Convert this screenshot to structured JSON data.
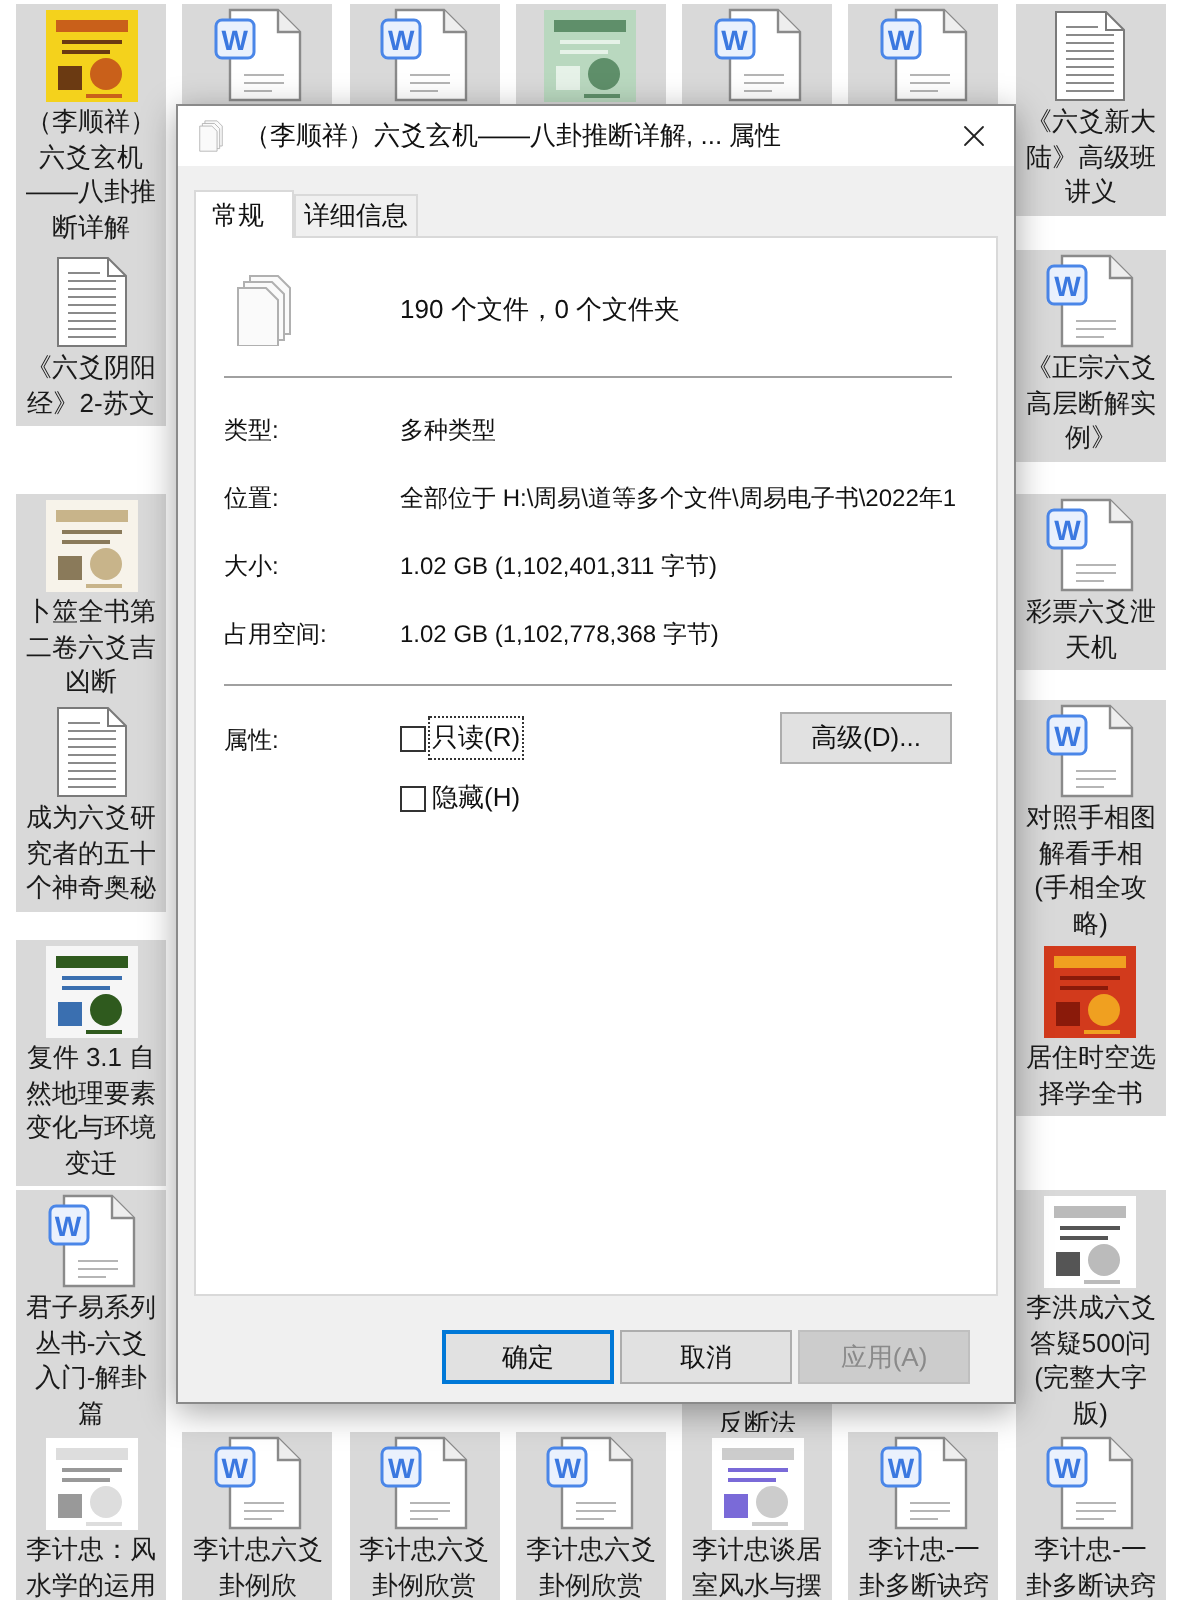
{
  "left_column": [
    {
      "kind": "picture",
      "name": "（李顺祥）六爻玄机——八卦推断详解"
    },
    {
      "kind": "document",
      "name": "《六爻阴阳经》2-苏文"
    },
    {
      "kind": "picture",
      "name": "卜筮全书第二卷六爻吉凶断"
    },
    {
      "kind": "document",
      "name": "成为六爻研究者的五十个神奇奥秘"
    },
    {
      "kind": "picture",
      "name": "复件 3.1 自然地理要素变化与环境变迁"
    },
    {
      "kind": "word",
      "icon_letter": "W",
      "name": "君子易系列丛书-六爻入门-解卦篇"
    },
    {
      "kind": "picture",
      "name": "李计忠：风水学的运用"
    }
  ],
  "right_column": [
    {
      "kind": "document",
      "name": "《六爻新大陆》高级班讲义"
    },
    {
      "kind": "word",
      "icon_letter": "W",
      "name": "《正宗六爻高层断解实例》"
    },
    {
      "kind": "word",
      "icon_letter": "W",
      "name": "彩票六爻泄天机"
    },
    {
      "kind": "word",
      "icon_letter": "W",
      "name": "对照手相图解看手相(手相全攻略)"
    },
    {
      "kind": "picture",
      "name": "居住时空选择学全书"
    },
    {
      "kind": "picture",
      "name": "李洪成六爻答疑500问(完整大字版)"
    },
    {
      "kind": "word",
      "icon_letter": "W",
      "name": "李计忠-一卦多断诀窍"
    }
  ],
  "top_middle": [
    {
      "kind": "word",
      "icon_letter": "W"
    },
    {
      "kind": "word",
      "icon_letter": "W"
    },
    {
      "kind": "picture"
    },
    {
      "kind": "word",
      "icon_letter": "W"
    },
    {
      "kind": "word",
      "icon_letter": "W"
    }
  ],
  "bottom_middle": [
    {
      "kind": "word",
      "icon_letter": "W",
      "name": "李计忠六爻卦例欣"
    },
    {
      "kind": "word",
      "icon_letter": "W",
      "name": "李计忠六爻卦例欣赏"
    },
    {
      "kind": "word",
      "icon_letter": "W",
      "name": "李计忠六爻卦例欣赏"
    },
    {
      "kind": "picture",
      "name": "李计忠谈居室风水与摆"
    },
    {
      "kind": "word",
      "icon_letter": "W",
      "name": "李计忠-一卦多断诀窍"
    }
  ],
  "covered_tile_label": "反断法",
  "dialog": {
    "title": "（李顺祥）六爻玄机——八卦推断详解, ... 属性",
    "tabs": [
      {
        "label": "常规",
        "selected": true
      },
      {
        "label": "详细信息",
        "selected": false
      }
    ],
    "summary": "190 个文件，0 个文件夹",
    "properties": [
      {
        "label": "类型:",
        "value": "多种类型"
      },
      {
        "label": "位置:",
        "value": "全部位于 H:\\周易\\道等多个文件\\周易电子书\\2022年1"
      },
      {
        "label": "大小:",
        "value": "1.02 GB (1,102,401,311 字节)"
      },
      {
        "label": "占用空间:",
        "value": "1.02 GB (1,102,778,368 字节)"
      }
    ],
    "attributes_label": "属性:",
    "checkboxes": [
      {
        "label": "只读(R)",
        "checked": false,
        "focused": true
      },
      {
        "label": "隐藏(H)",
        "checked": false,
        "focused": false
      }
    ],
    "advanced_button": "高级(D)...",
    "buttons": [
      {
        "label": "确定",
        "default": true,
        "disabled": false
      },
      {
        "label": "取消",
        "default": false,
        "disabled": false
      },
      {
        "label": "应用(A)",
        "default": false,
        "disabled": true
      }
    ]
  }
}
